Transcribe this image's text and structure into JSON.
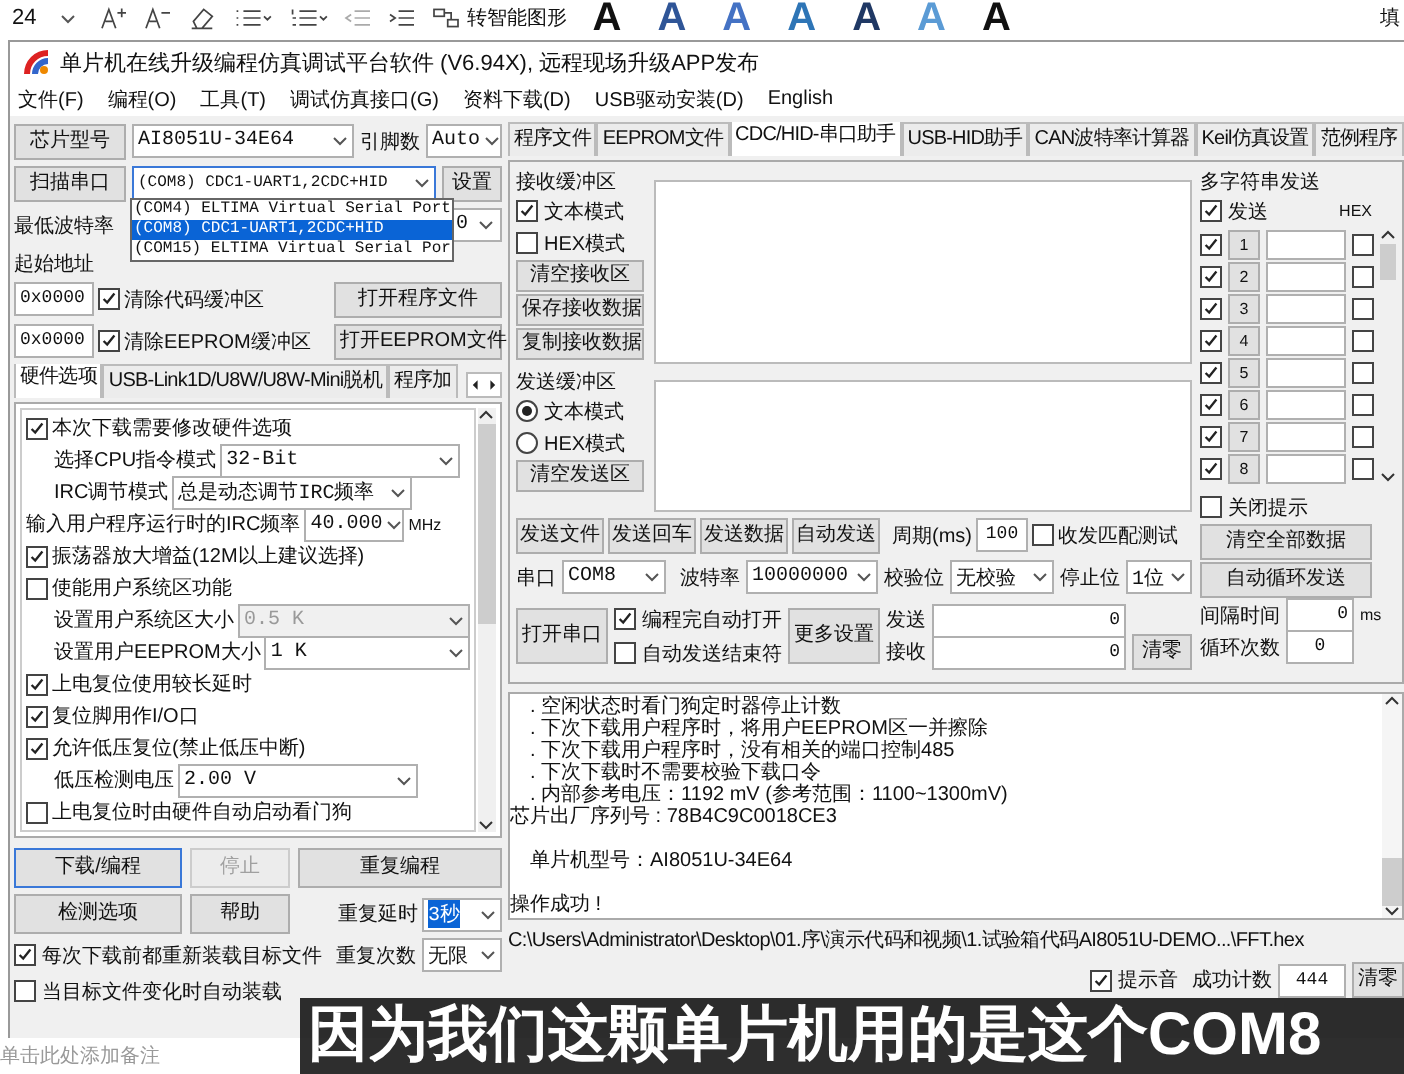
{
  "ribbon": {
    "font_size": "24",
    "smart_art": "转智能图形",
    "style_samples": [
      {
        "letter": "A",
        "color": "#111111"
      },
      {
        "letter": "A",
        "color": "#2f5597"
      },
      {
        "letter": "A",
        "color": "#4472c4"
      },
      {
        "letter": "A",
        "color": "#2e75b6"
      },
      {
        "letter": "A",
        "color": "#1f3864"
      },
      {
        "letter": "A",
        "color": "#5b9bd5"
      },
      {
        "letter": "A",
        "color": "#111111"
      }
    ],
    "fill": "填"
  },
  "window": {
    "title": "单片机在线升级编程仿真调试平台软件 (V6.94X), 远程现场升级APP发布"
  },
  "menu": [
    "文件(F)",
    "编程(O)",
    "工具(T)",
    "调试仿真接口(G)",
    "资料下载(D)",
    "USB驱动安装(D)",
    "English"
  ],
  "chip": {
    "button": "芯片型号",
    "value": "AI8051U-34E64",
    "pins_label": "引脚数",
    "pins_value": "Auto"
  },
  "port": {
    "button": "扫描串口",
    "value": "(COM8) CDC1-UART1,2CDC+HID",
    "settings_button": "设置",
    "options": [
      {
        "label": "(COM4) ELTIMA Virtual Serial Port",
        "selected": false
      },
      {
        "label": "(COM8) CDC1-UART1,2CDC+HID",
        "selected": true
      },
      {
        "label": "(COM15) ELTIMA Virtual Serial Por",
        "selected": false
      }
    ]
  },
  "min_baud": {
    "label": "最低波特率",
    "value": "0"
  },
  "start_address": {
    "label": "起始地址",
    "rows": [
      {
        "value": "0x0000",
        "checkbox": "清除代码缓冲区",
        "checked": true,
        "button": "打开程序文件"
      },
      {
        "value": "0x0000",
        "checkbox": "清除EEPROM缓冲区",
        "checked": true,
        "button": "打开EEPROM文件"
      }
    ]
  },
  "left_tabs": [
    {
      "label": "硬件选项",
      "selected": true
    },
    {
      "label": "USB-Link1D/U8W/U8W-Mini脱机",
      "selected": false
    },
    {
      "label": "程序加",
      "selected": false
    }
  ],
  "hardware_options": [
    {
      "kind": "checkbox",
      "label": "本次下载需要修改硬件选项",
      "checked": true
    },
    {
      "kind": "select",
      "label": "选择CPU指令模式",
      "value": "32-Bit",
      "disabled": false
    },
    {
      "kind": "select",
      "label": "IRC调节模式",
      "value": "总是动态调节IRC频率",
      "disabled": false
    },
    {
      "kind": "input",
      "label": "输入用户程序运行时的IRC频率",
      "value": "40.000",
      "unit": "MHz"
    },
    {
      "kind": "checkbox",
      "label": "振荡器放大增益(12M以上建议选择)",
      "checked": true
    },
    {
      "kind": "checkbox",
      "label": "使能用户系统区功能",
      "checked": false
    },
    {
      "kind": "select",
      "label": "设置用户系统区大小",
      "value": "0.5 K",
      "disabled": true
    },
    {
      "kind": "select",
      "label": "设置用户EEPROM大小",
      "value": "1   K",
      "disabled": false
    },
    {
      "kind": "checkbox",
      "label": "上电复位使用较长延时",
      "checked": true
    },
    {
      "kind": "checkbox",
      "label": "复位脚用作I/O口",
      "checked": true
    },
    {
      "kind": "checkbox",
      "label": "允许低压复位(禁止低压中断)",
      "checked": true
    },
    {
      "kind": "select",
      "label": "低压检测电压",
      "value": "2.00 V",
      "disabled": false
    },
    {
      "kind": "checkbox",
      "label": "上电复位时由硬件自动启动看门狗",
      "checked": false
    }
  ],
  "action_buttons": [
    {
      "label": "下载/编程",
      "disabled": false
    },
    {
      "label": "停止",
      "disabled": true
    },
    {
      "label": "重复编程",
      "disabled": false
    },
    {
      "label": "检测选项",
      "disabled": false
    },
    {
      "label": "帮助",
      "disabled": false
    }
  ],
  "repeat_delay": {
    "label": "重复延时",
    "value": "3秒",
    "highlighted": true
  },
  "repeat_count": {
    "label": "重复次数",
    "value": "无限",
    "highlighted": false
  },
  "reload_options": [
    {
      "label": "每次下载前都重新装载目标文件",
      "checked": true
    },
    {
      "label": "当目标文件变化时自动装载",
      "checked": false
    }
  ],
  "right_tabs": [
    {
      "label": "程序文件",
      "selected": false
    },
    {
      "label": "EEPROM文件",
      "selected": false
    },
    {
      "label": "CDC/HID-串口助手",
      "selected": true
    },
    {
      "label": "USB-HID助手",
      "selected": false
    },
    {
      "label": "CAN波特率计算器",
      "selected": false
    },
    {
      "label": "Keil仿真设置",
      "selected": false
    },
    {
      "label": "范例程序",
      "selected": false
    }
  ],
  "receive": {
    "title": "接收缓冲区",
    "modes": [
      {
        "label": "文本模式",
        "checked": true
      },
      {
        "label": "HEX模式",
        "checked": false
      }
    ],
    "buttons": [
      "清空接收区",
      "保存接收数据",
      "复制接收数据"
    ]
  },
  "send": {
    "title": "发送缓冲区",
    "modes": [
      {
        "label": "文本模式",
        "selected": true
      },
      {
        "label": "HEX模式",
        "selected": false
      }
    ],
    "buttons": [
      "清空发送区"
    ]
  },
  "send_actions": {
    "buttons": [
      "发送文件",
      "发送回车",
      "发送数据",
      "自动发送"
    ],
    "period_label": "周期(ms)",
    "period_value": "100",
    "match_test": {
      "label": "收发匹配测试",
      "checked": false
    }
  },
  "multi_send": {
    "title": "多字符串发送",
    "send": {
      "label": "发送",
      "checked": true
    },
    "hex_label": "HEX",
    "rows": [
      {
        "number": "1",
        "checked": true,
        "hex": false
      },
      {
        "number": "2",
        "checked": true,
        "hex": false
      },
      {
        "number": "3",
        "checked": true,
        "hex": false
      },
      {
        "number": "4",
        "checked": true,
        "hex": false
      },
      {
        "number": "5",
        "checked": true,
        "hex": false
      },
      {
        "number": "6",
        "checked": true,
        "hex": false
      },
      {
        "number": "7",
        "checked": true,
        "hex": false
      },
      {
        "number": "8",
        "checked": true,
        "hex": false
      }
    ],
    "close_tips": {
      "label": "关闭提示",
      "checked": false
    },
    "buttons": [
      "清空全部数据",
      "自动循环发送"
    ],
    "interval_label": "间隔时间",
    "interval_value": "0",
    "interval_unit": "ms",
    "loop_label": "循环次数",
    "loop_value": "0"
  },
  "serial": {
    "port_label": "串口",
    "port": "COM8",
    "baud_label": "波特率",
    "baud": "10000000",
    "parity_label": "校验位",
    "parity": "无校验",
    "stop_label": "停止位",
    "stop": "1位",
    "open_button": "打开串口",
    "options": [
      {
        "label": "编程完自动打开",
        "checked": true
      },
      {
        "label": "自动发送结束符",
        "checked": false
      }
    ],
    "more_button": "更多设置",
    "sent_label": "发送",
    "sent": "0",
    "received_label": "接收",
    "received": "0",
    "clear_button": "清零"
  },
  "log": [
    {
      "kind": "bullet",
      "text": ". 空闲状态时看门狗定时器停止计数"
    },
    {
      "kind": "bullet",
      "text": ". 下次下载用户程序时，将用户EEPROM区一并擦除"
    },
    {
      "kind": "bullet",
      "text": ". 下次下载用户程序时，没有相关的端口控制485"
    },
    {
      "kind": "bullet",
      "text": ". 下次下载时不需要校验下载口令"
    },
    {
      "kind": "bullet",
      "text": ". 内部参考电压：1192 mV (参考范围：1100~1300mV)"
    },
    {
      "kind": "plain",
      "text": "芯片出厂序列号 : 78B4C9C0018CE3"
    },
    {
      "kind": "spaced_indent",
      "text": "单片机型号：AI8051U-34E64"
    },
    {
      "kind": "spaced",
      "text": "操作成功 !"
    }
  ],
  "path": "C:\\Users\\Administrator\\Desktop\\01.序\\演示代码和视频\\1.试验箱代码AI8051U-DEMO...\\FFT.hex",
  "status_row": {
    "beep": {
      "label": "提示音",
      "checked": true
    },
    "count_label": "成功计数",
    "count": "444",
    "clear_button": "清零"
  },
  "notes_placeholder": "单击此处添加备注",
  "subtitle": "因为我们这颗单片机用的是这个COM8"
}
